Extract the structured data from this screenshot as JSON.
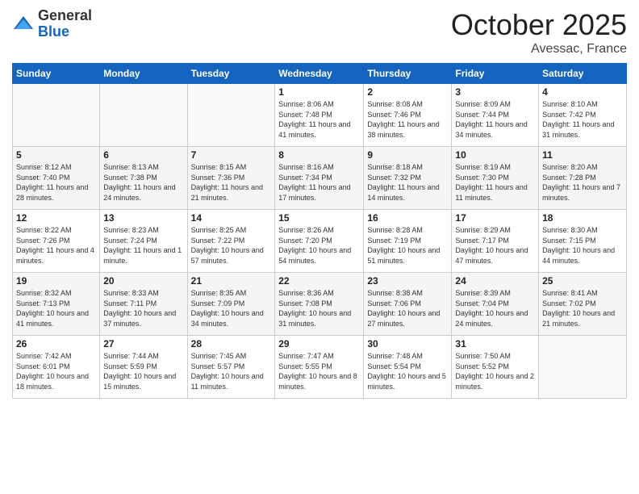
{
  "logo": {
    "general": "General",
    "blue": "Blue"
  },
  "header": {
    "month": "October 2025",
    "location": "Avessac, France"
  },
  "days_of_week": [
    "Sunday",
    "Monday",
    "Tuesday",
    "Wednesday",
    "Thursday",
    "Friday",
    "Saturday"
  ],
  "weeks": [
    [
      {
        "day": "",
        "info": ""
      },
      {
        "day": "",
        "info": ""
      },
      {
        "day": "",
        "info": ""
      },
      {
        "day": "1",
        "info": "Sunrise: 8:06 AM\nSunset: 7:48 PM\nDaylight: 11 hours\nand 41 minutes."
      },
      {
        "day": "2",
        "info": "Sunrise: 8:08 AM\nSunset: 7:46 PM\nDaylight: 11 hours\nand 38 minutes."
      },
      {
        "day": "3",
        "info": "Sunrise: 8:09 AM\nSunset: 7:44 PM\nDaylight: 11 hours\nand 34 minutes."
      },
      {
        "day": "4",
        "info": "Sunrise: 8:10 AM\nSunset: 7:42 PM\nDaylight: 11 hours\nand 31 minutes."
      }
    ],
    [
      {
        "day": "5",
        "info": "Sunrise: 8:12 AM\nSunset: 7:40 PM\nDaylight: 11 hours\nand 28 minutes."
      },
      {
        "day": "6",
        "info": "Sunrise: 8:13 AM\nSunset: 7:38 PM\nDaylight: 11 hours\nand 24 minutes."
      },
      {
        "day": "7",
        "info": "Sunrise: 8:15 AM\nSunset: 7:36 PM\nDaylight: 11 hours\nand 21 minutes."
      },
      {
        "day": "8",
        "info": "Sunrise: 8:16 AM\nSunset: 7:34 PM\nDaylight: 11 hours\nand 17 minutes."
      },
      {
        "day": "9",
        "info": "Sunrise: 8:18 AM\nSunset: 7:32 PM\nDaylight: 11 hours\nand 14 minutes."
      },
      {
        "day": "10",
        "info": "Sunrise: 8:19 AM\nSunset: 7:30 PM\nDaylight: 11 hours\nand 11 minutes."
      },
      {
        "day": "11",
        "info": "Sunrise: 8:20 AM\nSunset: 7:28 PM\nDaylight: 11 hours\nand 7 minutes."
      }
    ],
    [
      {
        "day": "12",
        "info": "Sunrise: 8:22 AM\nSunset: 7:26 PM\nDaylight: 11 hours\nand 4 minutes."
      },
      {
        "day": "13",
        "info": "Sunrise: 8:23 AM\nSunset: 7:24 PM\nDaylight: 11 hours\nand 1 minute."
      },
      {
        "day": "14",
        "info": "Sunrise: 8:25 AM\nSunset: 7:22 PM\nDaylight: 10 hours\nand 57 minutes."
      },
      {
        "day": "15",
        "info": "Sunrise: 8:26 AM\nSunset: 7:20 PM\nDaylight: 10 hours\nand 54 minutes."
      },
      {
        "day": "16",
        "info": "Sunrise: 8:28 AM\nSunset: 7:19 PM\nDaylight: 10 hours\nand 51 minutes."
      },
      {
        "day": "17",
        "info": "Sunrise: 8:29 AM\nSunset: 7:17 PM\nDaylight: 10 hours\nand 47 minutes."
      },
      {
        "day": "18",
        "info": "Sunrise: 8:30 AM\nSunset: 7:15 PM\nDaylight: 10 hours\nand 44 minutes."
      }
    ],
    [
      {
        "day": "19",
        "info": "Sunrise: 8:32 AM\nSunset: 7:13 PM\nDaylight: 10 hours\nand 41 minutes."
      },
      {
        "day": "20",
        "info": "Sunrise: 8:33 AM\nSunset: 7:11 PM\nDaylight: 10 hours\nand 37 minutes."
      },
      {
        "day": "21",
        "info": "Sunrise: 8:35 AM\nSunset: 7:09 PM\nDaylight: 10 hours\nand 34 minutes."
      },
      {
        "day": "22",
        "info": "Sunrise: 8:36 AM\nSunset: 7:08 PM\nDaylight: 10 hours\nand 31 minutes."
      },
      {
        "day": "23",
        "info": "Sunrise: 8:38 AM\nSunset: 7:06 PM\nDaylight: 10 hours\nand 27 minutes."
      },
      {
        "day": "24",
        "info": "Sunrise: 8:39 AM\nSunset: 7:04 PM\nDaylight: 10 hours\nand 24 minutes."
      },
      {
        "day": "25",
        "info": "Sunrise: 8:41 AM\nSunset: 7:02 PM\nDaylight: 10 hours\nand 21 minutes."
      }
    ],
    [
      {
        "day": "26",
        "info": "Sunrise: 7:42 AM\nSunset: 6:01 PM\nDaylight: 10 hours\nand 18 minutes."
      },
      {
        "day": "27",
        "info": "Sunrise: 7:44 AM\nSunset: 5:59 PM\nDaylight: 10 hours\nand 15 minutes."
      },
      {
        "day": "28",
        "info": "Sunrise: 7:45 AM\nSunset: 5:57 PM\nDaylight: 10 hours\nand 11 minutes."
      },
      {
        "day": "29",
        "info": "Sunrise: 7:47 AM\nSunset: 5:55 PM\nDaylight: 10 hours\nand 8 minutes."
      },
      {
        "day": "30",
        "info": "Sunrise: 7:48 AM\nSunset: 5:54 PM\nDaylight: 10 hours\nand 5 minutes."
      },
      {
        "day": "31",
        "info": "Sunrise: 7:50 AM\nSunset: 5:52 PM\nDaylight: 10 hours\nand 2 minutes."
      },
      {
        "day": "",
        "info": ""
      }
    ]
  ]
}
